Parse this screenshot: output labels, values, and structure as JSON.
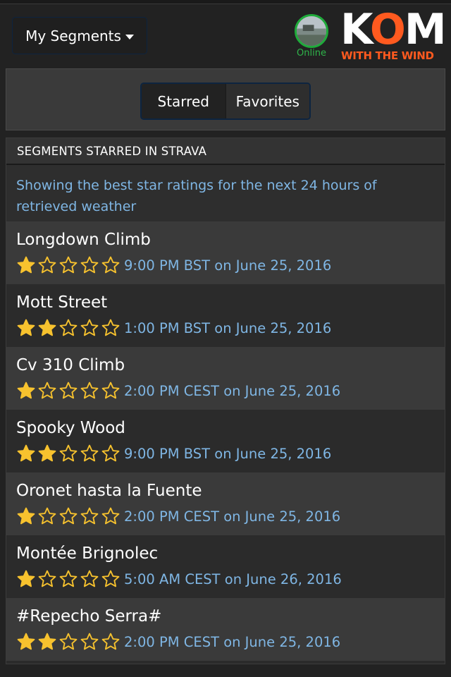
{
  "header": {
    "menu_label": "My Segments",
    "status": "Online",
    "logo_main": "KOM",
    "logo_sub": "WITH THE WIND"
  },
  "tabs": [
    {
      "label": "Starred",
      "active": true
    },
    {
      "label": "Favorites",
      "active": false
    }
  ],
  "list": {
    "title": "SEGMENTS STARRED IN STRAVA",
    "info": "Showing the best star ratings for the next 24 hours of retrieved weather",
    "max_stars": 5,
    "segments": [
      {
        "name": "Longdown Climb",
        "stars": 1,
        "when": "9:00 PM BST on June 25, 2016"
      },
      {
        "name": "Mott Street",
        "stars": 2,
        "when": "1:00 PM BST on June 25, 2016"
      },
      {
        "name": "Cv 310 Climb",
        "stars": 1,
        "when": "2:00 PM CEST on June 25, 2016"
      },
      {
        "name": "Spooky Wood",
        "stars": 2,
        "when": "9:00 PM BST on June 25, 2016"
      },
      {
        "name": "Oronet hasta la Fuente",
        "stars": 1,
        "when": "2:00 PM CEST on June 25, 2016"
      },
      {
        "name": "Montée Brignolec",
        "stars": 1,
        "when": "5:00 AM CEST on June 26, 2016"
      },
      {
        "name": "#Repecho Serra#",
        "stars": 2,
        "when": "2:00 PM CEST on June 25, 2016"
      }
    ]
  },
  "colors": {
    "accent_blue": "#7fb6e4",
    "star_filled": "#f7c22e",
    "online_green": "#2fb44a",
    "logo_orange": "#ff5a1f"
  },
  "icons": {
    "filled_star": "star-filled-icon",
    "empty_star": "star-empty-icon",
    "menu_caret": "chevron-down-icon"
  }
}
